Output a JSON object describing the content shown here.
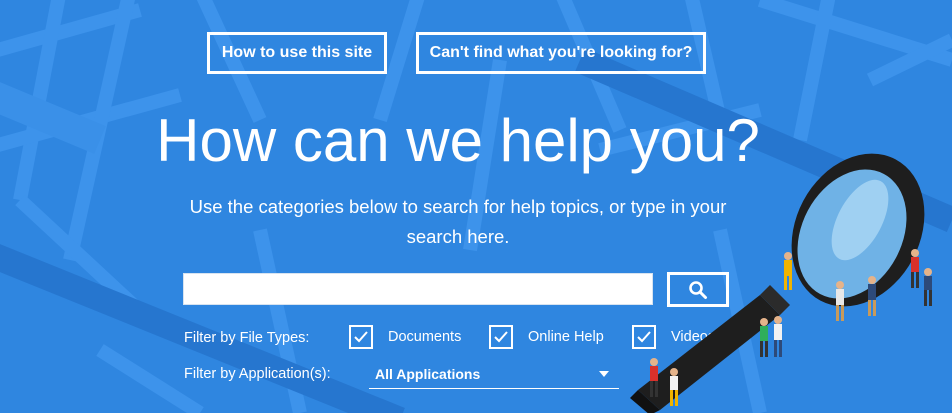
{
  "top_buttons": {
    "how_to_use": "How to use this site",
    "cant_find": "Can't find what you're looking for?"
  },
  "hero": {
    "title": "How can we help you?",
    "subtitle": "Use the categories below to search for help topics, or type in your search here."
  },
  "search": {
    "value": "",
    "placeholder": "",
    "button_icon": "search-icon"
  },
  "filters": {
    "file_types_label": "Filter by File Types:",
    "file_types": [
      {
        "label": "Documents",
        "checked": true
      },
      {
        "label": "Online Help",
        "checked": true
      },
      {
        "label": "Videos",
        "checked": true
      }
    ],
    "application_label": "Filter by Application(s):",
    "application_selected": "All Applications"
  },
  "colors": {
    "background": "#2f86e0",
    "line_light": "#3b92ea",
    "line_dark": "#2577cf",
    "foreground": "#ffffff"
  }
}
